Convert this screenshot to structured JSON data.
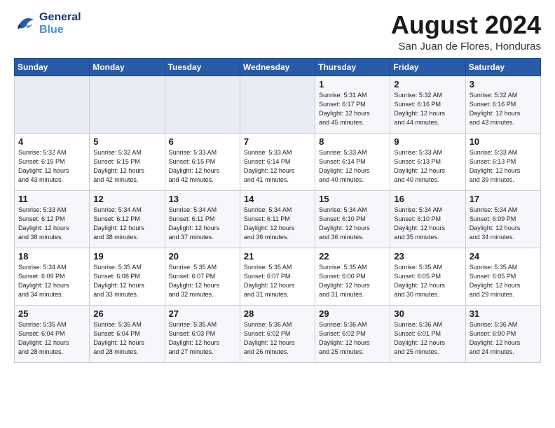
{
  "logo": {
    "line1": "General",
    "line2": "Blue"
  },
  "title": "August 2024",
  "location": "San Juan de Flores, Honduras",
  "headers": [
    "Sunday",
    "Monday",
    "Tuesday",
    "Wednesday",
    "Thursday",
    "Friday",
    "Saturday"
  ],
  "weeks": [
    [
      {
        "day": "",
        "lines": []
      },
      {
        "day": "",
        "lines": []
      },
      {
        "day": "",
        "lines": []
      },
      {
        "day": "",
        "lines": []
      },
      {
        "day": "1",
        "lines": [
          "Sunrise: 5:31 AM",
          "Sunset: 6:17 PM",
          "Daylight: 12 hours",
          "and 45 minutes."
        ]
      },
      {
        "day": "2",
        "lines": [
          "Sunrise: 5:32 AM",
          "Sunset: 6:16 PM",
          "Daylight: 12 hours",
          "and 44 minutes."
        ]
      },
      {
        "day": "3",
        "lines": [
          "Sunrise: 5:32 AM",
          "Sunset: 6:16 PM",
          "Daylight: 12 hours",
          "and 43 minutes."
        ]
      }
    ],
    [
      {
        "day": "4",
        "lines": [
          "Sunrise: 5:32 AM",
          "Sunset: 6:15 PM",
          "Daylight: 12 hours",
          "and 43 minutes."
        ]
      },
      {
        "day": "5",
        "lines": [
          "Sunrise: 5:32 AM",
          "Sunset: 6:15 PM",
          "Daylight: 12 hours",
          "and 42 minutes."
        ]
      },
      {
        "day": "6",
        "lines": [
          "Sunrise: 5:33 AM",
          "Sunset: 6:15 PM",
          "Daylight: 12 hours",
          "and 42 minutes."
        ]
      },
      {
        "day": "7",
        "lines": [
          "Sunrise: 5:33 AM",
          "Sunset: 6:14 PM",
          "Daylight: 12 hours",
          "and 41 minutes."
        ]
      },
      {
        "day": "8",
        "lines": [
          "Sunrise: 5:33 AM",
          "Sunset: 6:14 PM",
          "Daylight: 12 hours",
          "and 40 minutes."
        ]
      },
      {
        "day": "9",
        "lines": [
          "Sunrise: 5:33 AM",
          "Sunset: 6:13 PM",
          "Daylight: 12 hours",
          "and 40 minutes."
        ]
      },
      {
        "day": "10",
        "lines": [
          "Sunrise: 5:33 AM",
          "Sunset: 6:13 PM",
          "Daylight: 12 hours",
          "and 39 minutes."
        ]
      }
    ],
    [
      {
        "day": "11",
        "lines": [
          "Sunrise: 5:33 AM",
          "Sunset: 6:12 PM",
          "Daylight: 12 hours",
          "and 38 minutes."
        ]
      },
      {
        "day": "12",
        "lines": [
          "Sunrise: 5:34 AM",
          "Sunset: 6:12 PM",
          "Daylight: 12 hours",
          "and 38 minutes."
        ]
      },
      {
        "day": "13",
        "lines": [
          "Sunrise: 5:34 AM",
          "Sunset: 6:11 PM",
          "Daylight: 12 hours",
          "and 37 minutes."
        ]
      },
      {
        "day": "14",
        "lines": [
          "Sunrise: 5:34 AM",
          "Sunset: 6:11 PM",
          "Daylight: 12 hours",
          "and 36 minutes."
        ]
      },
      {
        "day": "15",
        "lines": [
          "Sunrise: 5:34 AM",
          "Sunset: 6:10 PM",
          "Daylight: 12 hours",
          "and 36 minutes."
        ]
      },
      {
        "day": "16",
        "lines": [
          "Sunrise: 5:34 AM",
          "Sunset: 6:10 PM",
          "Daylight: 12 hours",
          "and 35 minutes."
        ]
      },
      {
        "day": "17",
        "lines": [
          "Sunrise: 5:34 AM",
          "Sunset: 6:09 PM",
          "Daylight: 12 hours",
          "and 34 minutes."
        ]
      }
    ],
    [
      {
        "day": "18",
        "lines": [
          "Sunrise: 5:34 AM",
          "Sunset: 6:09 PM",
          "Daylight: 12 hours",
          "and 34 minutes."
        ]
      },
      {
        "day": "19",
        "lines": [
          "Sunrise: 5:35 AM",
          "Sunset: 6:08 PM",
          "Daylight: 12 hours",
          "and 33 minutes."
        ]
      },
      {
        "day": "20",
        "lines": [
          "Sunrise: 5:35 AM",
          "Sunset: 6:07 PM",
          "Daylight: 12 hours",
          "and 32 minutes."
        ]
      },
      {
        "day": "21",
        "lines": [
          "Sunrise: 5:35 AM",
          "Sunset: 6:07 PM",
          "Daylight: 12 hours",
          "and 31 minutes."
        ]
      },
      {
        "day": "22",
        "lines": [
          "Sunrise: 5:35 AM",
          "Sunset: 6:06 PM",
          "Daylight: 12 hours",
          "and 31 minutes."
        ]
      },
      {
        "day": "23",
        "lines": [
          "Sunrise: 5:35 AM",
          "Sunset: 6:05 PM",
          "Daylight: 12 hours",
          "and 30 minutes."
        ]
      },
      {
        "day": "24",
        "lines": [
          "Sunrise: 5:35 AM",
          "Sunset: 6:05 PM",
          "Daylight: 12 hours",
          "and 29 minutes."
        ]
      }
    ],
    [
      {
        "day": "25",
        "lines": [
          "Sunrise: 5:35 AM",
          "Sunset: 6:04 PM",
          "Daylight: 12 hours",
          "and 28 minutes."
        ]
      },
      {
        "day": "26",
        "lines": [
          "Sunrise: 5:35 AM",
          "Sunset: 6:04 PM",
          "Daylight: 12 hours",
          "and 28 minutes."
        ]
      },
      {
        "day": "27",
        "lines": [
          "Sunrise: 5:35 AM",
          "Sunset: 6:03 PM",
          "Daylight: 12 hours",
          "and 27 minutes."
        ]
      },
      {
        "day": "28",
        "lines": [
          "Sunrise: 5:36 AM",
          "Sunset: 6:02 PM",
          "Daylight: 12 hours",
          "and 26 minutes."
        ]
      },
      {
        "day": "29",
        "lines": [
          "Sunrise: 5:36 AM",
          "Sunset: 6:02 PM",
          "Daylight: 12 hours",
          "and 25 minutes."
        ]
      },
      {
        "day": "30",
        "lines": [
          "Sunrise: 5:36 AM",
          "Sunset: 6:01 PM",
          "Daylight: 12 hours",
          "and 25 minutes."
        ]
      },
      {
        "day": "31",
        "lines": [
          "Sunrise: 5:36 AM",
          "Sunset: 6:00 PM",
          "Daylight: 12 hours",
          "and 24 minutes."
        ]
      }
    ]
  ]
}
